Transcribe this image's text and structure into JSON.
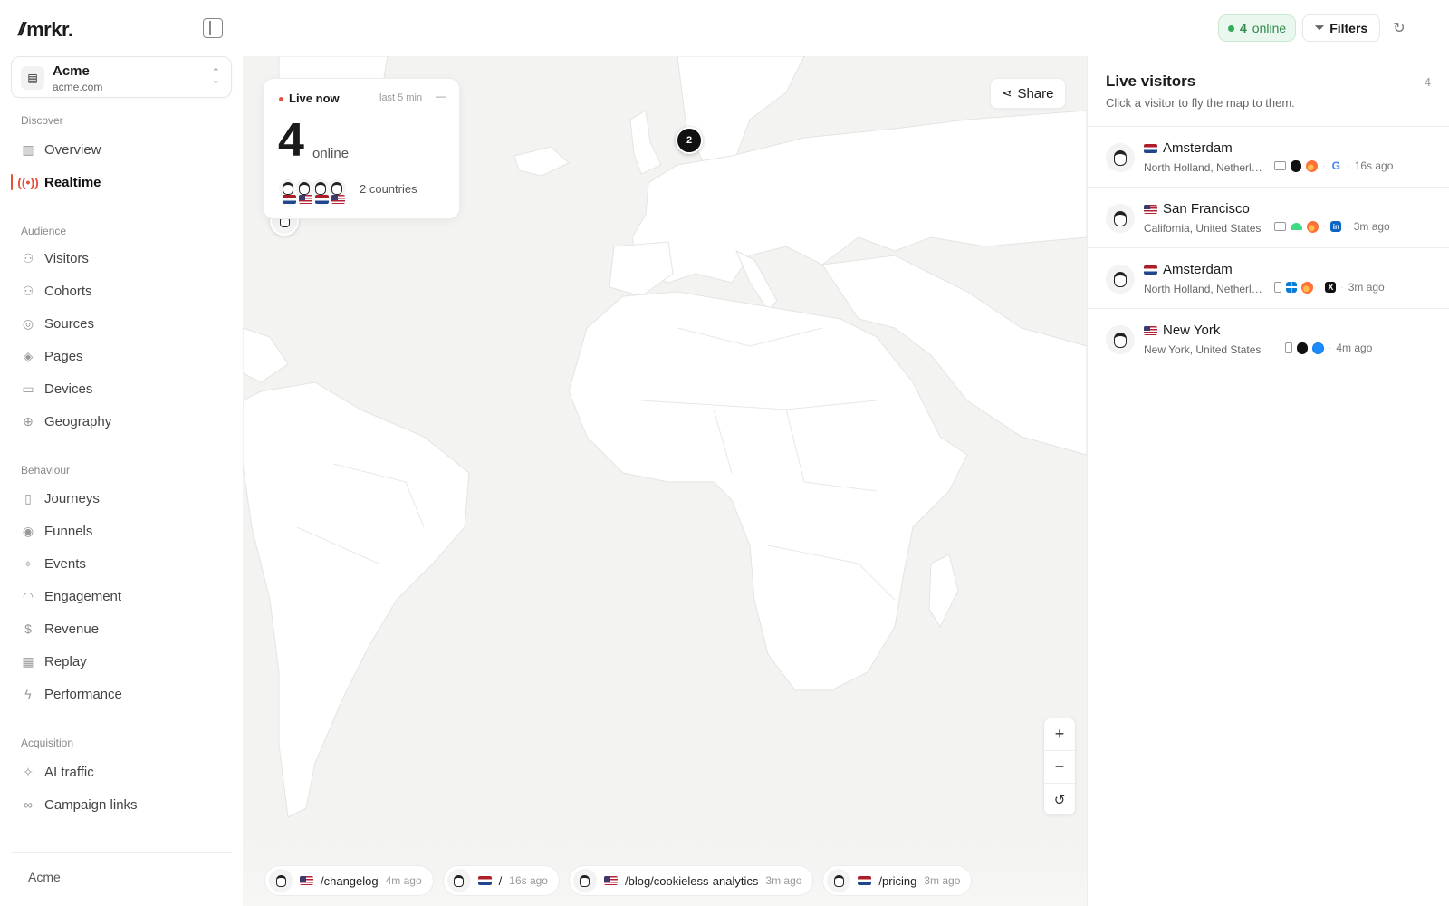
{
  "app": {
    "logo": "mrkr."
  },
  "workspace": {
    "name": "Acme",
    "domain": "acme.com"
  },
  "nav": {
    "discover": {
      "title": "Discover",
      "items": [
        {
          "label": "Overview",
          "icon": "bar-chart-icon"
        },
        {
          "label": "Realtime",
          "icon": "broadcast-icon",
          "active": true
        }
      ]
    },
    "audience": {
      "title": "Audience",
      "items": [
        {
          "label": "Visitors",
          "icon": "users-icon"
        },
        {
          "label": "Cohorts",
          "icon": "cohorts-icon"
        },
        {
          "label": "Sources",
          "icon": "compass-icon"
        },
        {
          "label": "Pages",
          "icon": "layers-icon"
        },
        {
          "label": "Devices",
          "icon": "devices-icon"
        },
        {
          "label": "Geography",
          "icon": "globe-icon"
        }
      ]
    },
    "behaviour": {
      "title": "Behaviour",
      "items": [
        {
          "label": "Journeys",
          "icon": "map-icon"
        },
        {
          "label": "Funnels",
          "icon": "target-icon"
        },
        {
          "label": "Events",
          "icon": "pointer-icon"
        },
        {
          "label": "Engagement",
          "icon": "gauge-icon"
        },
        {
          "label": "Revenue",
          "icon": "dollar-icon"
        },
        {
          "label": "Replay",
          "icon": "film-icon"
        },
        {
          "label": "Performance",
          "icon": "lightning-icon"
        }
      ]
    },
    "acquisition": {
      "title": "Acquisition",
      "items": [
        {
          "label": "AI traffic",
          "icon": "sparkles-icon"
        },
        {
          "label": "Campaign links",
          "icon": "link-icon"
        }
      ]
    },
    "footer": "Acme"
  },
  "topbar": {
    "online_count": "4",
    "online_label": "online",
    "filters_label": "Filters"
  },
  "live_card": {
    "title": "Live now",
    "window": "last 5 min",
    "minimize": "—",
    "count": "4",
    "count_label": "online",
    "countries": "2 countries"
  },
  "map": {
    "share_label": "Share",
    "cluster_count": "2"
  },
  "feed": [
    {
      "flag": "us",
      "path": "/changelog",
      "time": "4m ago"
    },
    {
      "flag": "nl",
      "path": "/",
      "time": "16s ago"
    },
    {
      "flag": "us",
      "path": "/blog/cookieless-analytics",
      "time": "3m ago"
    },
    {
      "flag": "nl",
      "path": "/pricing",
      "time": "3m ago"
    }
  ],
  "panel": {
    "title": "Live visitors",
    "subtitle": "Click a visitor to fly the map to them.",
    "count": "4",
    "visitors": [
      {
        "city": "Amsterdam",
        "region": "North Holland, Netherlands",
        "flag": "nl",
        "device": "desktop",
        "os": "apple",
        "browser": "firefox",
        "source": "google",
        "time": "16s ago"
      },
      {
        "city": "San Francisco",
        "region": "California, United States",
        "flag": "us",
        "device": "desktop",
        "os": "android",
        "browser": "firefox",
        "source": "linkedin",
        "time": "3m ago"
      },
      {
        "city": "Amsterdam",
        "region": "North Holland, Netherlands",
        "flag": "nl",
        "device": "mobile",
        "os": "windows",
        "browser": "firefox",
        "source": "x",
        "time": "3m ago"
      },
      {
        "city": "New York",
        "region": "New York, United States",
        "flag": "us",
        "device": "mobile",
        "os": "apple",
        "browser": "safari",
        "source": "",
        "time": "4m ago"
      }
    ]
  },
  "colors": {
    "accent": "#e5533d",
    "online": "#2fae5b",
    "map_bg": "#f3f3f1",
    "land": "#ffffff"
  }
}
